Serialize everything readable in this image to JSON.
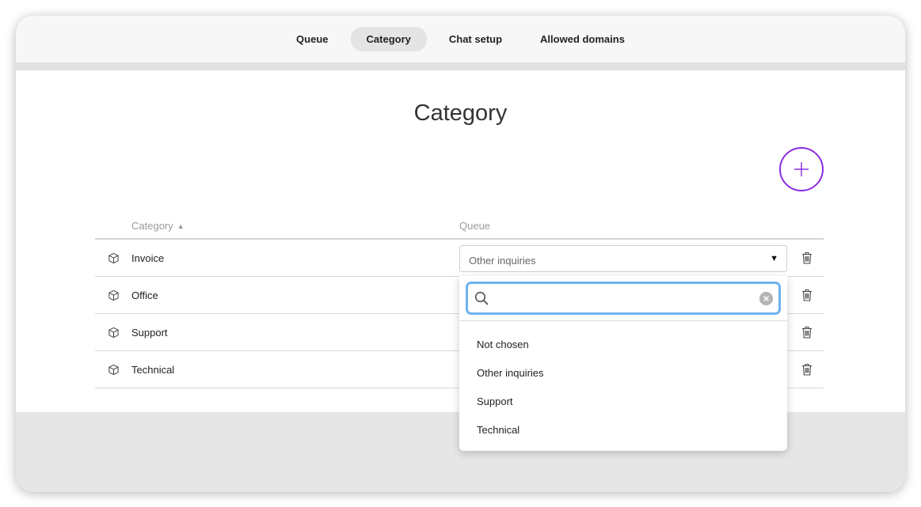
{
  "tabs": [
    {
      "label": "Queue",
      "active": false
    },
    {
      "label": "Category",
      "active": true
    },
    {
      "label": "Chat setup",
      "active": false
    },
    {
      "label": "Allowed domains",
      "active": false
    }
  ],
  "page": {
    "title": "Category"
  },
  "table": {
    "headers": {
      "category": "Category",
      "queue": "Queue"
    },
    "sort": "ascending",
    "rows": [
      {
        "category": "Invoice",
        "queue": "Other inquiries"
      },
      {
        "category": "Office",
        "queue": ""
      },
      {
        "category": "Support",
        "queue": ""
      },
      {
        "category": "Technical",
        "queue": ""
      }
    ]
  },
  "dropdown": {
    "search_value": "",
    "search_placeholder": "",
    "options": [
      "Not chosen",
      "Other inquiries",
      "Support",
      "Technical"
    ]
  },
  "colors": {
    "accent": "#8a2be2",
    "focus": "#6db3ef"
  },
  "icons": {
    "add": "plus-icon",
    "row": "cube-icon",
    "delete": "trash-icon",
    "sort": "sort-ascending-icon",
    "search": "search-icon",
    "clear": "clear-icon"
  }
}
